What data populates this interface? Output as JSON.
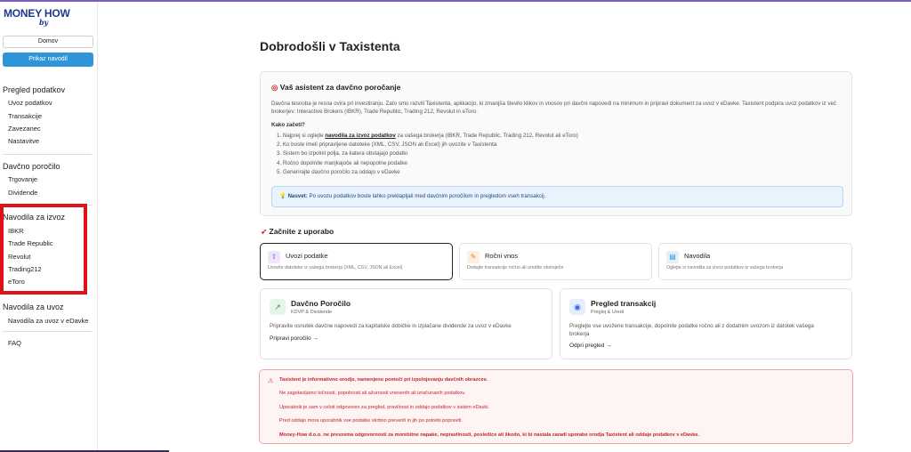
{
  "brand": {
    "logo_main": "MONEY HOW",
    "logo_sub": "by"
  },
  "sidebar": {
    "home_label": "Domov",
    "guide_label": "Prikaz navodil",
    "sections": [
      {
        "title": "Pregled podatkov",
        "items": [
          "Uvoz podatkov",
          "Transakcije",
          "Zavezanec",
          "Nastavitve"
        ]
      },
      {
        "title": "Davčno poročilo",
        "items": [
          "Trgovanje",
          "Dividende"
        ]
      },
      {
        "title": "Navodila za izvoz",
        "items": [
          "IBKR",
          "Trade Republic",
          "Revolut",
          "Trading212",
          "eToro"
        ]
      },
      {
        "title": "Navodila za uvoz",
        "items": [
          "Navodila za uvoz v eDavke"
        ]
      }
    ],
    "faq_label": "FAQ"
  },
  "main": {
    "title": "Dobrodošli v Taxistenta",
    "intro": {
      "heading": "Vaš asistent za davčno poročanje",
      "paragraph": "Davčna tesnoba je resna ovira pri investiranju. Zato smo razvili Taxistenta, aplikacijo, ki zmanjša število klikov in vnosov pri davčni napovedi na minimum in pripravi dokument za uvoz v eDavke. Taxistent podpira uvoz podatkov iz več brokerjev: Interactive Brokers (IBKR), Trade Republic, Trading 212, Revolut in eToro.",
      "how_label": "Kako začeti?",
      "step1_pre": "1. Najprej si oglejte ",
      "step1_link": "navodila za izvoz podatkov",
      "step1_post": " za vašega brokerja (IBKR, Trade Republic, Trading 212, Revolut ali eToro)",
      "steps": [
        "2. Ko boste imeli pripravljene datoteke (XML, CSV, JSON ali Excel) jih uvozite v Taxistenta",
        "3. Sistem bo izpolnil polja, za katera obstajajo podatki",
        "4. Ročno dopolnite manjkajoče ali nepopolne podatke",
        "5. Generirajte davčno poročilo za oddajo v eDavke"
      ],
      "tip_label": "Nasvet:",
      "tip_text": " Po uvozu podatkov boste lahko preklapljali med davčnim poročilom in pregledom vseh transakcij."
    },
    "start_title": "Začnite z uporabo",
    "feature_cards": [
      {
        "title": "Uvozi podatke",
        "desc": "Uvozite datoteke iz vašega brokerja (XML, CSV, JSON ali Excel)"
      },
      {
        "title": "Ročni vnos",
        "desc": "Dodajte transakcije ročno ali uredite obstoječe"
      },
      {
        "title": "Navodila",
        "desc": "Oglejte si navodila za izvoz podatkov iz vašega brokerja"
      }
    ],
    "report_card": {
      "title": "Davčno Poročilo",
      "subtitle": "KDVP & Dividende",
      "desc": "Pripravite osnutek davčne napovedi za kapitalske dobičke in izplačane dividende za uvoz v eDavke",
      "link": "Pripravi poročilo →"
    },
    "tx_card": {
      "title": "Pregled transakcij",
      "subtitle": "Preglej & Uredi",
      "desc_line1": "Preglejte vse uvožene transakcije, dopolnite podatke ročno ali z dodatnim uvozom iz datotek vašega",
      "desc_line2": "brokerja",
      "link": "Odpri pregled →"
    },
    "warning": {
      "lines": [
        "Taxistent je informativno orodje, namenjeno pomoči pri izpolnjevanju davčnih obrazcev.",
        "Ne zagotavljamo točnosti, popolnosti ali ažurnosti vnesenih ali izračunanih podatkov.",
        "Uporabnik je sam v celoti odgovoren za pregled, pravilnost in oddajo podatkov v sistem eDavki.",
        "Pred oddajo mora uporabnik vse podatke skrbno preveriti in jih po potrebi popraviti.",
        "Money-How d.o.o. ne prevzema odgovornosti za morebitne napake, nepravilnosti, posledice ali škodo, ki bi nastala zaradi uporabe orodja Taxistent ali oddaje podatkov v eDavke."
      ]
    }
  },
  "colors": {
    "accent": "#2d95d8",
    "warning": "#c0262d",
    "highlight_box": "#e0101b"
  }
}
